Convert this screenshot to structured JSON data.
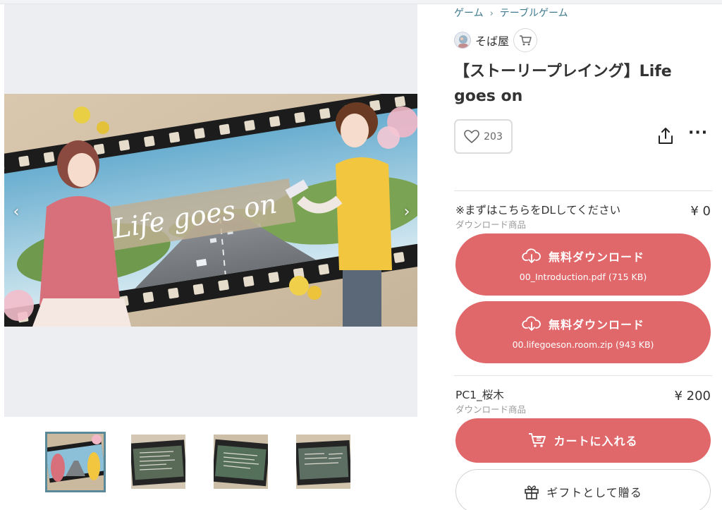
{
  "breadcrumb": [
    "ゲーム",
    "テーブルゲーム"
  ],
  "shop": {
    "name": "そば屋"
  },
  "product": {
    "title": "【ストーリープレイング】Life goes on",
    "likes": "203"
  },
  "hero": {
    "logo_text": "Life goes on"
  },
  "items": [
    {
      "name": "※まずはこちらをDLしてください",
      "type": "ダウンロード商品",
      "price": "¥ 0",
      "downloads": [
        {
          "label": "無料ダウンロード",
          "file": "00_Introduction.pdf (715 KB)"
        },
        {
          "label": "無料ダウンロード",
          "file": "00.lifegoeson.room.zip (943 KB)"
        }
      ]
    },
    {
      "name": "PC1_桜木",
      "type": "ダウンロード商品",
      "price": "¥ 200",
      "cart_label": "カートに入れる",
      "gift_label": "ギフトとして贈る"
    }
  ],
  "colors": {
    "accent_red": "#e0686a",
    "link_teal": "#3f7a8f",
    "gallery_bg": "#eceef2"
  },
  "icons": [
    "chevron-left-icon",
    "chevron-right-icon",
    "heart-icon",
    "share-icon",
    "more-icon",
    "cart-icon",
    "download-cloud-icon",
    "gift-icon"
  ]
}
